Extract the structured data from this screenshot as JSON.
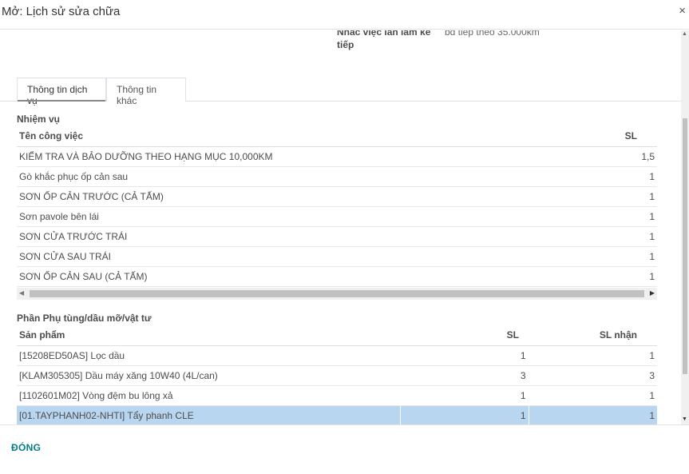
{
  "modal": {
    "title": "Mở: Lịch sử sửa chữa",
    "close_symbol": "×"
  },
  "reminder": {
    "label": "Nhắc việc lần làm kế tiếp",
    "value": "bd tiếp theo 35.000km"
  },
  "tabs": [
    {
      "label": "Thông tin dịch vụ",
      "active": true
    },
    {
      "label": "Thông tin khác",
      "active": false
    }
  ],
  "tasks": {
    "section_title": "Nhiệm vụ",
    "headers": {
      "name": "Tên công việc",
      "qty": "SL"
    },
    "rows": [
      {
        "name": "KIỂM TRA VÀ BẢO DƯỠNG THEO HẠNG MỤC 10,000KM",
        "qty": "1,5"
      },
      {
        "name": "Gò khắc phục ốp cản sau",
        "qty": "1"
      },
      {
        "name": "SƠN ỐP CẢN TRƯỚC (CẢ TẤM)",
        "qty": "1"
      },
      {
        "name": "Sơn pavole bên lái",
        "qty": "1"
      },
      {
        "name": "SƠN CỬA TRƯỚC TRÁI",
        "qty": "1"
      },
      {
        "name": "SƠN CỬA SAU TRÁI",
        "qty": "1"
      },
      {
        "name": "SƠN ỐP CẢN SAU (CẢ TẤM)",
        "qty": "1"
      }
    ]
  },
  "parts": {
    "section_title": "Phần Phụ tùng/dầu mỡ/vật tư",
    "headers": {
      "product": "Sản phẩm",
      "qty": "SL",
      "qty_received": "SL nhận"
    },
    "rows": [
      {
        "product": "[15208ED50AS] Lọc dầu",
        "qty": "1",
        "qty_received": "1",
        "selected": false
      },
      {
        "product": "[KLAM305305] Dầu máy xăng 10W40 (4L/can)",
        "qty": "3",
        "qty_received": "3",
        "selected": false
      },
      {
        "product": "[1102601M02] Vòng đệm bu lông xả",
        "qty": "1",
        "qty_received": "1",
        "selected": false
      },
      {
        "product": "[01.TAYPHANH02-NHTI] Tẩy phanh CLE",
        "qty": "1",
        "qty_received": "1",
        "selected": true
      }
    ]
  },
  "footer": {
    "close_label": "ĐÓNG"
  },
  "icons": {
    "close": "close-icon",
    "scroll_left": "▶",
    "scroll_right": "◀"
  }
}
